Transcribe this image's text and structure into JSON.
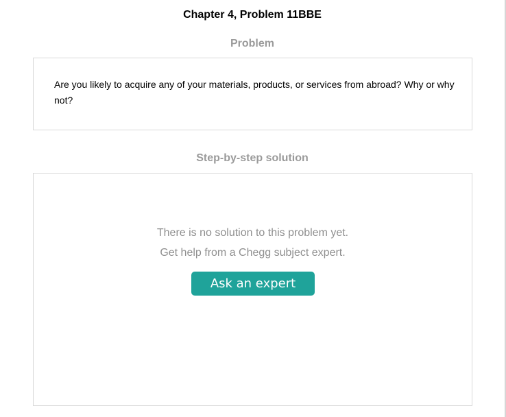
{
  "header": {
    "title": "Chapter 4, Problem 11BBE"
  },
  "problem": {
    "heading": "Problem",
    "text": "Are you likely to acquire any of your materials, products, or services from abroad? Why or why not?"
  },
  "solution": {
    "heading": "Step-by-step solution",
    "empty_message": "There is no solution to this problem yet.",
    "help_message": "Get help from a Chegg subject expert.",
    "ask_button_label": "Ask an expert"
  },
  "colors": {
    "accent": "#1fa39a",
    "muted_text": "#8f8f8f",
    "heading_gray": "#9a9a9a",
    "border": "#d8d8d8"
  }
}
